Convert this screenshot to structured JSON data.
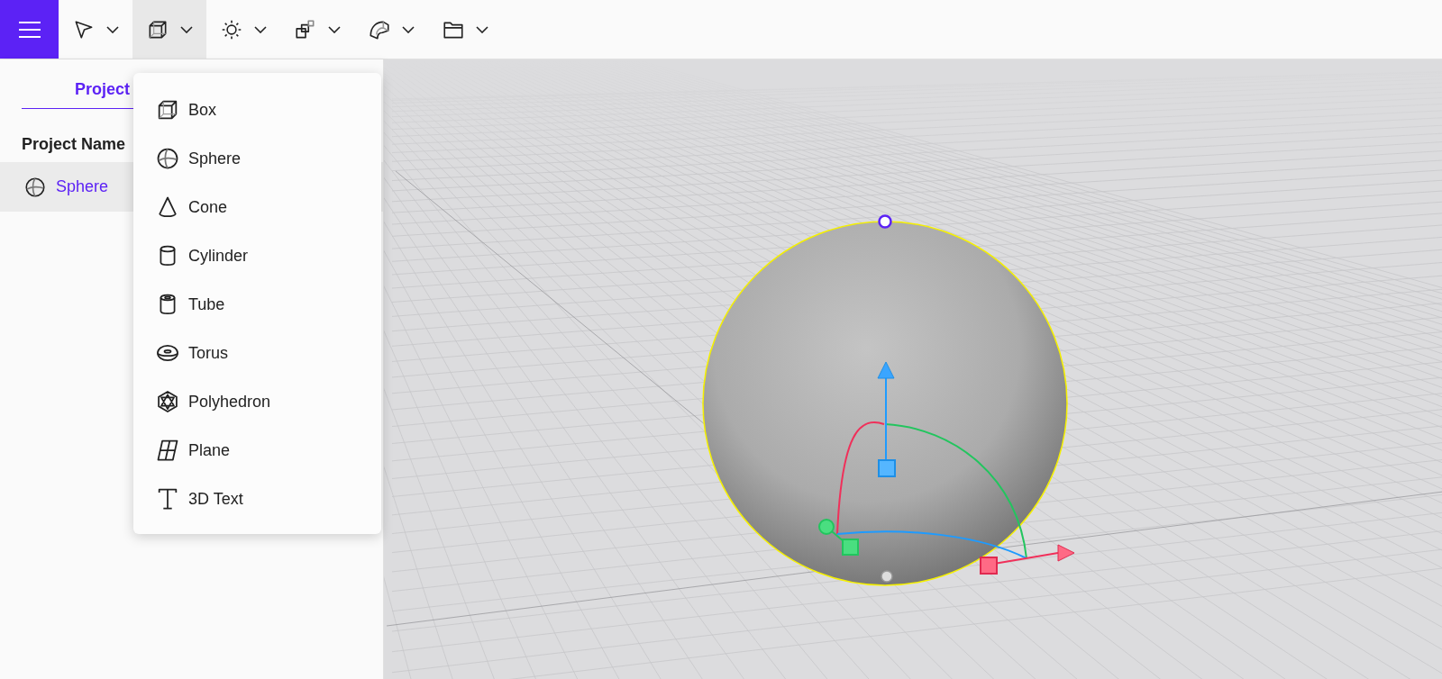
{
  "toolbar": {
    "tools": [
      {
        "kind": "select",
        "selected": false
      },
      {
        "kind": "box",
        "selected": true
      },
      {
        "kind": "light",
        "selected": false
      },
      {
        "kind": "transform",
        "selected": false
      },
      {
        "kind": "modify",
        "selected": false
      },
      {
        "kind": "folder",
        "selected": false
      }
    ]
  },
  "sidebar": {
    "tabs": [
      {
        "label": "Project",
        "selected": true
      }
    ],
    "heading": "Project Name",
    "objects": [
      {
        "label": "Sphere",
        "kind": "sphere",
        "selected": true
      }
    ]
  },
  "add_menu": {
    "items": [
      {
        "label": "Box",
        "kind": "box"
      },
      {
        "label": "Sphere",
        "kind": "sphere"
      },
      {
        "label": "Cone",
        "kind": "cone"
      },
      {
        "label": "Cylinder",
        "kind": "cylinder"
      },
      {
        "label": "Tube",
        "kind": "tube"
      },
      {
        "label": "Torus",
        "kind": "torus"
      },
      {
        "label": "Polyhedron",
        "kind": "polyhedron"
      },
      {
        "label": "Plane",
        "kind": "plane"
      },
      {
        "label": "3D Text",
        "kind": "text"
      }
    ]
  },
  "viewport": {
    "sphere": {
      "selected": true
    }
  }
}
